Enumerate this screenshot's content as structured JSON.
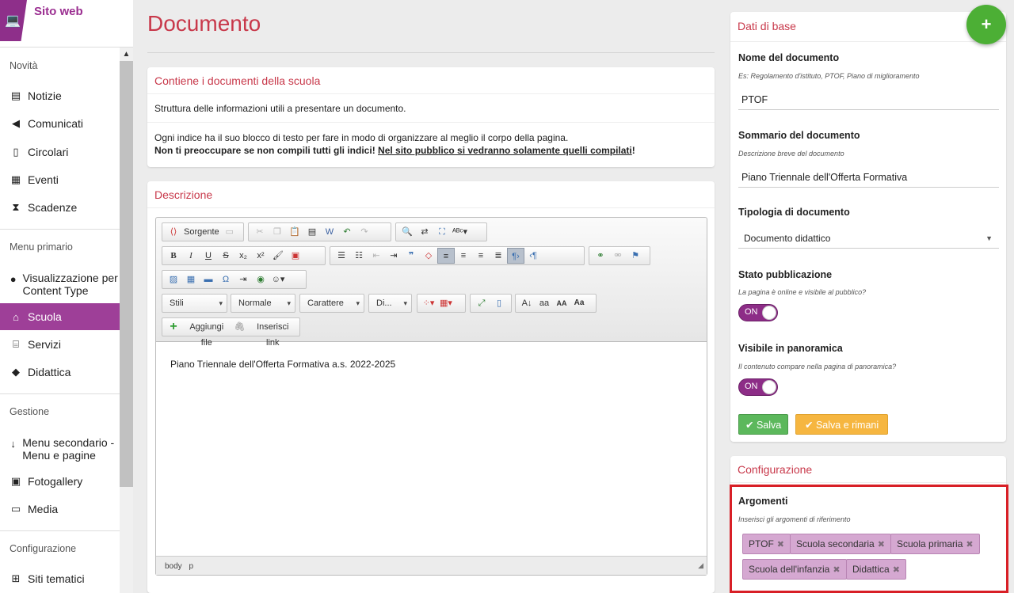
{
  "brand": {
    "name": "Sito web"
  },
  "sidebar": {
    "sections": {
      "news": "Novità",
      "primary": "Menu primario",
      "manage": "Gestione",
      "config": "Configurazione"
    },
    "items": {
      "notizie": "Notizie",
      "comunicati": "Comunicati",
      "circolari": "Circolari",
      "eventi": "Eventi",
      "scadenze": "Scadenze",
      "visual": "Visualizzazione per Content Type",
      "scuola": "Scuola",
      "servizi": "Servizi",
      "didattica": "Didattica",
      "menusec": "Menu secondario - Menu e pagine",
      "fotogallery": "Fotogallery",
      "media": "Media",
      "siti": "Siti tematici"
    }
  },
  "page": {
    "title": "Documento"
  },
  "intro": {
    "heading": "Contiene i documenti della scuola",
    "line1": "Struttura delle informazioni utili a presentare un documento.",
    "line2": "Ogni indice ha il suo blocco di testo per fare in modo di organizzare al meglio il corpo della pagina.",
    "bold": "Non ti preoccupare se non compili tutti gli indici!",
    "underline": "Nel sito pubblico si vedranno solamente quelli compilati",
    "end": "!"
  },
  "descrizione": {
    "heading": "Descrizione",
    "toolbar": {
      "source": "Sorgente",
      "styles": "Stili",
      "format": "Normale",
      "font": "Carattere",
      "size": "Di...",
      "add_file": "Aggiungi file",
      "insert_link": "Inserisci link"
    },
    "content": "Piano Triennale dell'Offerta Formativa a.s. 2022-2025",
    "path": {
      "body": "body",
      "p": "p"
    }
  },
  "dati": {
    "heading": "Dati di base",
    "name": {
      "label": "Nome del documento",
      "hint": "Es: Regolamento d'istituto, PTOF, Piano di miglioramento",
      "value": "PTOF"
    },
    "summary": {
      "label": "Sommario del documento",
      "hint": "Descrizione breve del documento",
      "value": "Piano Triennale dell'Offerta Formativa"
    },
    "type": {
      "label": "Tipologia di documento",
      "value": "Documento didattico"
    },
    "status": {
      "label": "Stato pubblicazione",
      "hint": "La pagina è online e visibile al pubblico?",
      "toggle": "ON"
    },
    "visible": {
      "label": "Visibile in panoramica",
      "hint": "Il contenuto compare nella pagina di panoramica?",
      "toggle": "ON"
    },
    "save": "Salva",
    "save_stay": "Salva e rimani"
  },
  "config": {
    "heading": "Configurazione",
    "label": "Argomenti",
    "hint": "Inserisci gli argomenti di riferimento",
    "tags": [
      "PTOF",
      "Scuola secondaria",
      "Scuola primaria",
      "Scuola dell'infanzia",
      "Didattica"
    ]
  },
  "fab": "+",
  "colors": {
    "accent": "#9e3f98",
    "title": "#c8384a",
    "fab": "#4caf35",
    "save": "#5cb85c",
    "save_stay": "#f6b640",
    "highlight": "#d81f26"
  }
}
